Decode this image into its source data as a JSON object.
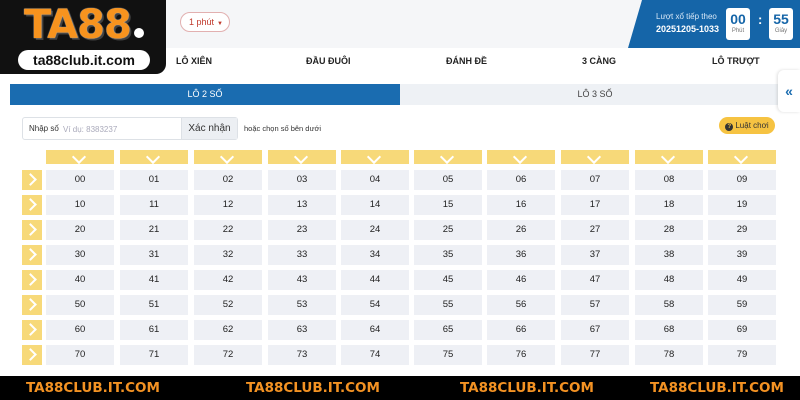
{
  "brand": {
    "logo_text": "TA88",
    "url_badge": "ta88club.it.com"
  },
  "header": {
    "period_select": "1 phút",
    "next_draw_label": "Lượt xổ tiếp theo",
    "draw_code": "20251205-1033",
    "timer": {
      "minutes": "00",
      "minutes_unit": "Phút",
      "seconds": "55",
      "seconds_unit": "Giây"
    }
  },
  "nav": [
    "LÔ XIÊN",
    "ĐẦU ĐUÔI",
    "ĐÁNH ĐỀ",
    "3 CÀNG",
    "LÔ TRƯỢT"
  ],
  "tabs": [
    {
      "label": "LÔ 2 SỐ",
      "active": true
    },
    {
      "label": "LÔ 3 SỐ",
      "active": false
    }
  ],
  "side_toggle": "«",
  "input": {
    "label": "Nhập số",
    "placeholder": "Ví dụ: 8383237",
    "value": "",
    "confirm_label": "Xác nhận",
    "hint": "hoặc chọn số bên dưới"
  },
  "rules_button": "Luật chơi",
  "grid_rows": [
    [
      "00",
      "01",
      "02",
      "03",
      "04",
      "05",
      "06",
      "07",
      "08",
      "09"
    ],
    [
      "10",
      "11",
      "12",
      "13",
      "14",
      "15",
      "16",
      "17",
      "18",
      "19"
    ],
    [
      "20",
      "21",
      "22",
      "23",
      "24",
      "25",
      "26",
      "27",
      "28",
      "29"
    ],
    [
      "30",
      "31",
      "32",
      "33",
      "34",
      "35",
      "36",
      "37",
      "38",
      "39"
    ],
    [
      "40",
      "41",
      "42",
      "43",
      "44",
      "45",
      "46",
      "47",
      "48",
      "49"
    ],
    [
      "50",
      "51",
      "52",
      "53",
      "54",
      "55",
      "56",
      "57",
      "58",
      "59"
    ],
    [
      "60",
      "61",
      "62",
      "63",
      "64",
      "65",
      "66",
      "67",
      "68",
      "69"
    ],
    [
      "70",
      "71",
      "72",
      "73",
      "74",
      "75",
      "76",
      "77",
      "78",
      "79"
    ]
  ],
  "footer": [
    "TA88CLUB.IT.COM",
    "TA88CLUB.IT.COM",
    "TA88CLUB.IT.COM",
    "TA88CLUB.IT.COM"
  ],
  "colors": {
    "primary": "#1a6cb0",
    "accent_yellow": "#f7d979",
    "brand_orange": "#f7931e"
  }
}
